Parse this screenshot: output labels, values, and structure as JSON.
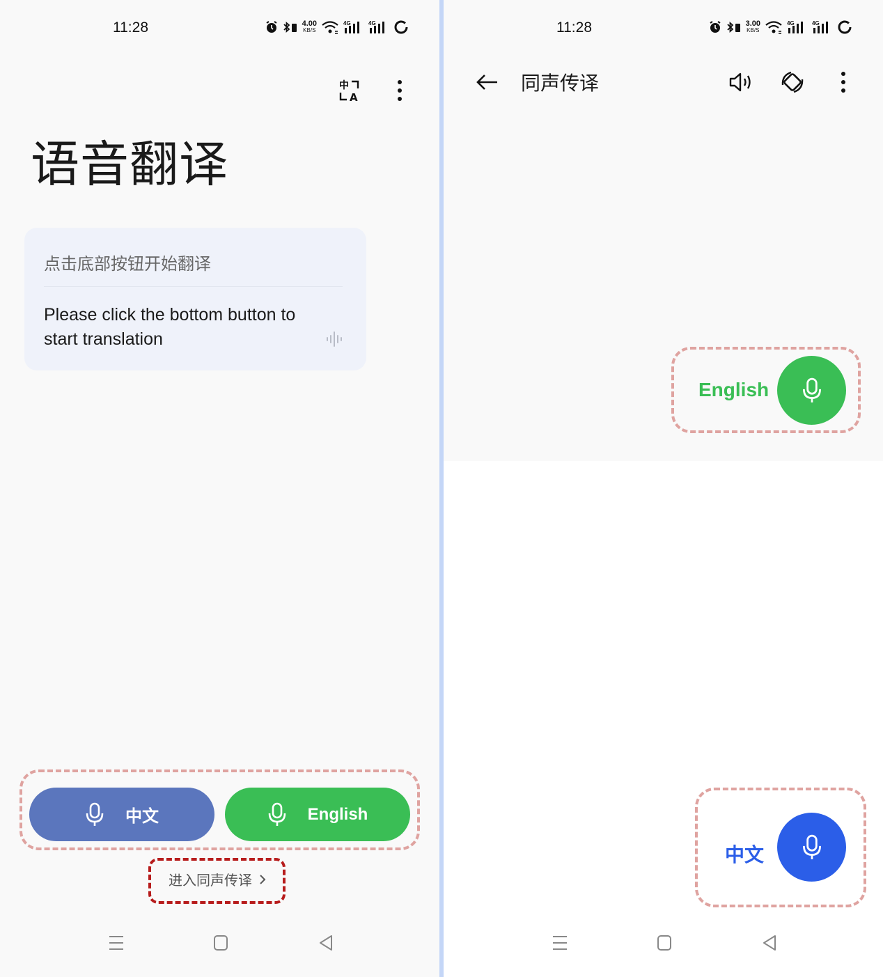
{
  "left": {
    "status": {
      "time": "11:28",
      "speed_value": "4.00",
      "speed_unit": "KB/S"
    },
    "title": "语音翻译",
    "card": {
      "source_text": "点击底部按钮开始翻译",
      "translation_text": "Please click the bottom button to start translation"
    },
    "buttons": {
      "chinese": "中文",
      "english": "English"
    },
    "simultaneous_link": "进入同声传译"
  },
  "right": {
    "status": {
      "time": "11:28",
      "speed_value": "3.00",
      "speed_unit": "KB/S"
    },
    "app_title": "同声传译",
    "top_lang": "English",
    "bottom_lang": "中文"
  },
  "colors": {
    "blue_pill": "#5b76bd",
    "green": "#3abe55",
    "blue_accent": "#2b5ee8",
    "dash_light": "#dfa3a0",
    "dash_dark": "#b71c1c"
  }
}
